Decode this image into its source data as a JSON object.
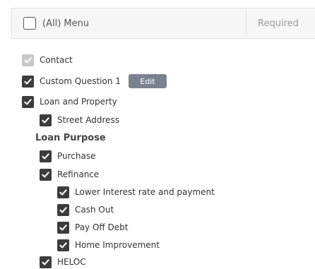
{
  "header": {
    "all_label": "(All) Menu",
    "required_label": "Required"
  },
  "items": {
    "contact": {
      "label": "Contact",
      "checked": true,
      "disabled": true
    },
    "custom_question_1": {
      "label": "Custom Question 1",
      "checked": true,
      "edit_label": "Edit"
    },
    "loan_and_property": {
      "label": "Loan and Property",
      "checked": true
    },
    "street_address": {
      "label": "Street Address",
      "checked": true
    },
    "loan_purpose_title": "Loan Purpose",
    "purchase": {
      "label": "Purchase",
      "checked": true
    },
    "refinance": {
      "label": "Refinance",
      "checked": true
    },
    "lower_interest": {
      "label": "Lower Interest rate and payment",
      "checked": true
    },
    "cash_out": {
      "label": "Cash Out",
      "checked": true
    },
    "pay_off_debt": {
      "label": "Pay Off Debt",
      "checked": true
    },
    "home_improvement": {
      "label": "Home Improvement",
      "checked": true
    },
    "heloc": {
      "label": "HELOC",
      "checked": true
    }
  },
  "colors": {
    "checkbox_checked": "#3c3c3c",
    "checkbox_disabled": "#c8c8c8",
    "edit_button": "#7a8290"
  },
  "icons": {
    "checkmark": "checkmark-icon"
  }
}
